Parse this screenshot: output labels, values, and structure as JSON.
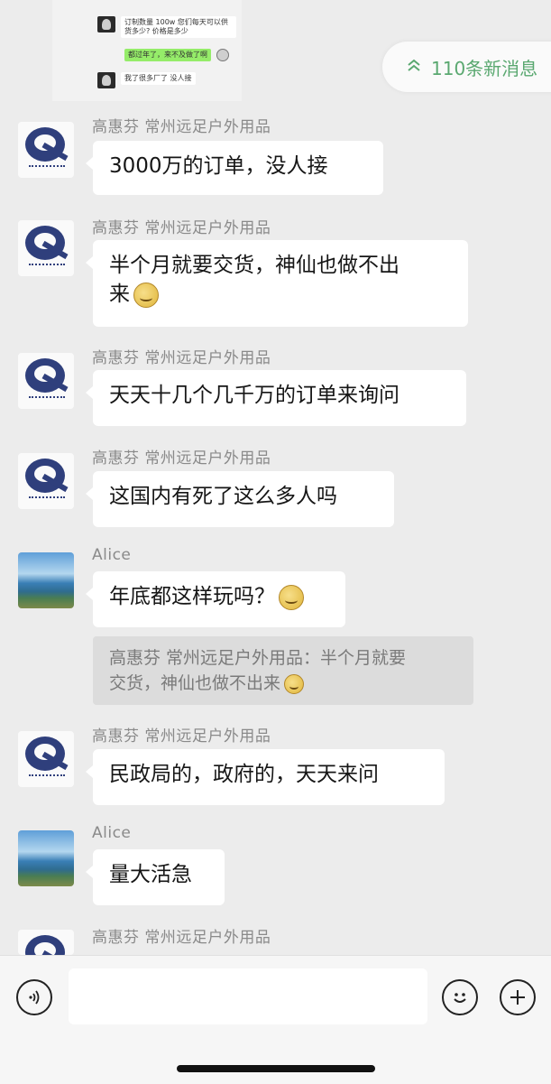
{
  "forwarded_snippet": {
    "line1": "订制数量 100w 您们每天可以供货多少? 价格是多少",
    "line2": "都过年了，来不及做了啊",
    "line3": "我了很多厂了 没人接"
  },
  "new_messages_pill": {
    "label": "110条新消息",
    "icon": "double-chevron-up-icon"
  },
  "messages": [
    {
      "sender": "高惠芬 常州远足户外用品",
      "avatar": "company-logo",
      "text": "3000万的订单，没人接"
    },
    {
      "sender": "高惠芬 常州远足户外用品",
      "avatar": "company-logo",
      "text": "半个月就要交货，神仙也做不出来",
      "line1": "半个月就要交货，神仙也做不出",
      "line2": "来",
      "emoji": "laugh-cry-emoji"
    },
    {
      "sender": "高惠芬 常州远足户外用品",
      "avatar": "company-logo",
      "text": "天天十几个几千万的订单来询问"
    },
    {
      "sender": "高惠芬 常州远足户外用品",
      "avatar": "company-logo",
      "text": "这国内有死了这么多人吗"
    },
    {
      "sender": "Alice",
      "avatar": "landscape-photo",
      "text": "年底都这样玩吗？",
      "emoji": "laugh-cry-emoji",
      "quote_line1": "高惠芬 常州远足户外用品：半个月就要",
      "quote_line2": "交货，神仙也做不出来"
    },
    {
      "sender": "高惠芬 常州远足户外用品",
      "avatar": "company-logo",
      "text": "民政局的，政府的，天天来问"
    },
    {
      "sender": "Alice",
      "avatar": "landscape-photo",
      "text": "量大活急"
    },
    {
      "sender": "高惠芬 常州远足户外用品",
      "avatar": "company-logo",
      "text": ""
    }
  ],
  "input_bar": {
    "voice_icon": "voice-icon",
    "emoji_icon": "smiley-icon",
    "more_icon": "plus-icon"
  },
  "colors": {
    "background": "#ececec",
    "bubble": "#ffffff",
    "pill_text": "#5aa870",
    "sender_text": "#8a8a8a",
    "quote_bg": "#dcdcdc"
  }
}
